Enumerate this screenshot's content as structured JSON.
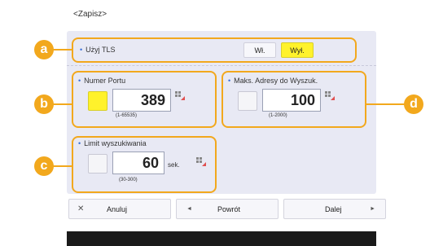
{
  "header": {
    "title": "<Zapisz>"
  },
  "tls": {
    "label": "Użyj TLS",
    "on_label": "Wł.",
    "off_label": "Wył.",
    "selected": "Wył."
  },
  "port": {
    "label": "Numer Portu",
    "value": "389",
    "range": "(1-65535)"
  },
  "max_addresses": {
    "label": "Maks. Adresy do Wyszuk.",
    "value": "100",
    "range": "(1-2000)"
  },
  "search_limit": {
    "label": "Limit wyszukiwania",
    "value": "60",
    "unit": "sek.",
    "range": "(30-300)"
  },
  "callouts": {
    "a": "a",
    "b": "b",
    "c": "c",
    "d": "d"
  },
  "buttons": {
    "cancel": "Anuluj",
    "back": "Powrót",
    "next": "Dalej"
  },
  "colors": {
    "accent": "#f2a81d",
    "selected_yellow": "#fff22b",
    "panel": "#e8e9f4"
  }
}
